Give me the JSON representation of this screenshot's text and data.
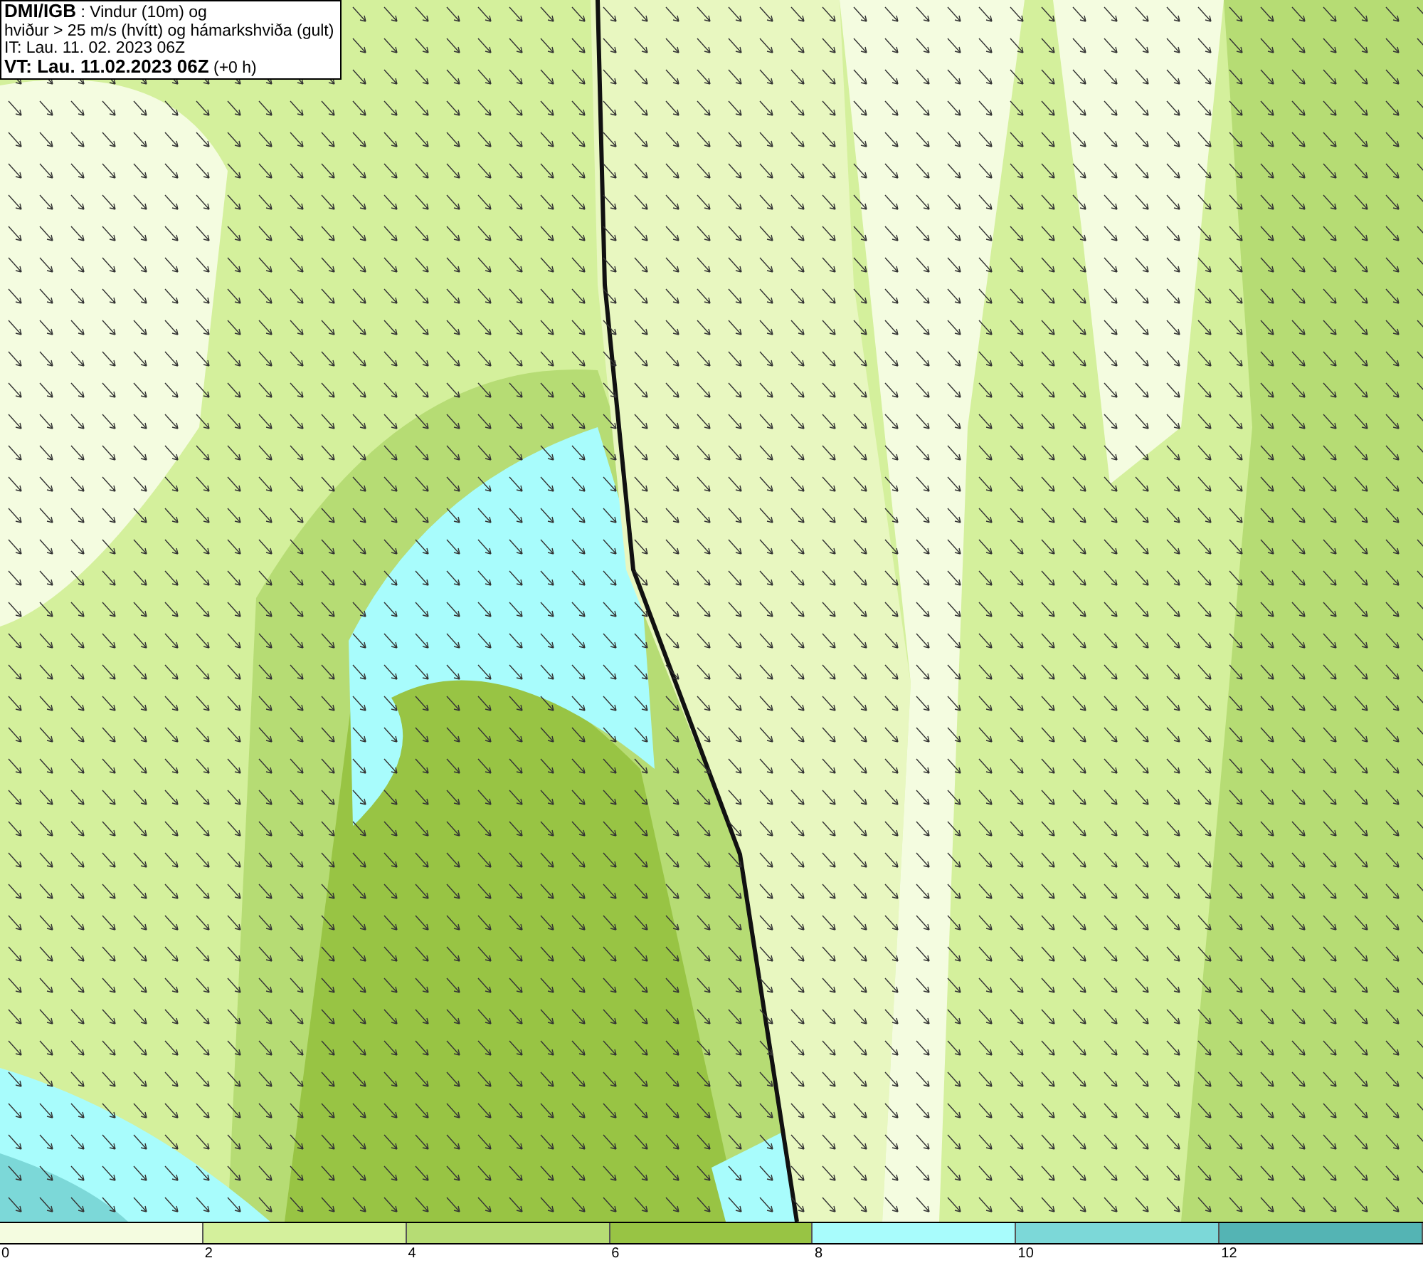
{
  "title_box": {
    "lines": [
      "**DMI/IGB** : Vindur (10m) og",
      "hviður > 25 m/s (hvítt) og hámarkshviða (gult)",
      "IT: Lau. 11. 02. 2023 06Z",
      "**VT: Lau. 11.02.2023 06Z** (+0 h)"
    ]
  },
  "legend": {
    "bins": [
      {
        "color": "#f4fce0"
      },
      {
        "color": "#d4f09c"
      },
      {
        "color": "#b6dc74"
      },
      {
        "color": "#98c444"
      },
      {
        "color": "#a8fcfc"
      },
      {
        "color": "#7cd8d8"
      },
      {
        "color": "#54b4b4"
      }
    ],
    "ticks": [
      "0",
      "2",
      "4",
      "6",
      "8",
      "10",
      "12"
    ]
  }
}
